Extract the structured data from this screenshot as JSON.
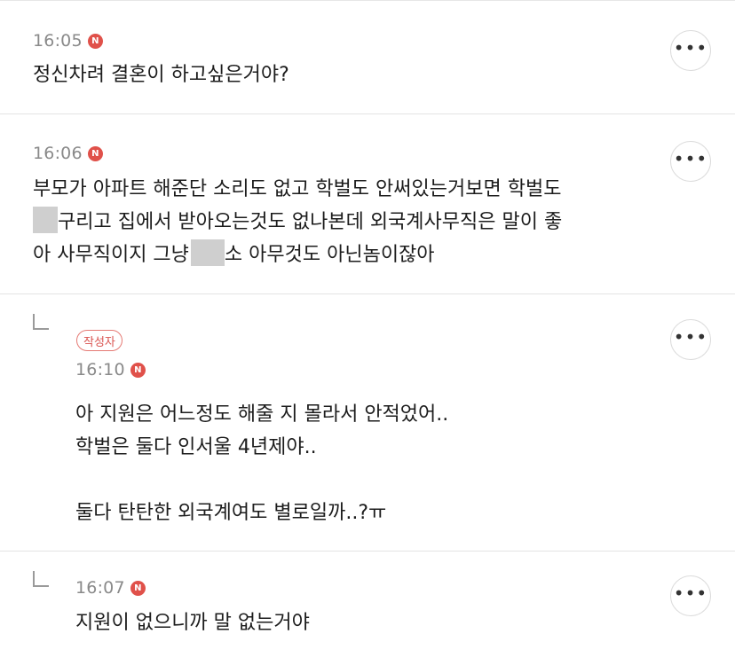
{
  "badges": {
    "new": "N",
    "author": "작성자"
  },
  "more_button": "•••",
  "comments": [
    {
      "time": "16:05",
      "lines": [
        "정신차려 결혼이 하고싶은거야?"
      ]
    },
    {
      "time": "16:06",
      "line1": "부모가 아파트 해준단 소리도 없고 학벌도 안써있는거보면 학벌도",
      "line2_after": "구리고 집에서 받아오는것도 없나본데 외국계사무직은 말이 좋",
      "line3_before": "아 사무직이지 그냥",
      "line3_after": "소 아무것도 아닌놈이잖아"
    },
    {
      "time": "16:10",
      "is_author": true,
      "lines": [
        "아 지원은 어느정도 해줄 지 몰라서 안적었어..",
        "학벌은 둘다 인서울 4년제야..",
        "",
        "둘다 탄탄한 외국계여도 별로일까..?ㅠ"
      ]
    },
    {
      "time": "16:07",
      "lines": [
        "지원이 없으니까 말 없는거야"
      ]
    }
  ]
}
